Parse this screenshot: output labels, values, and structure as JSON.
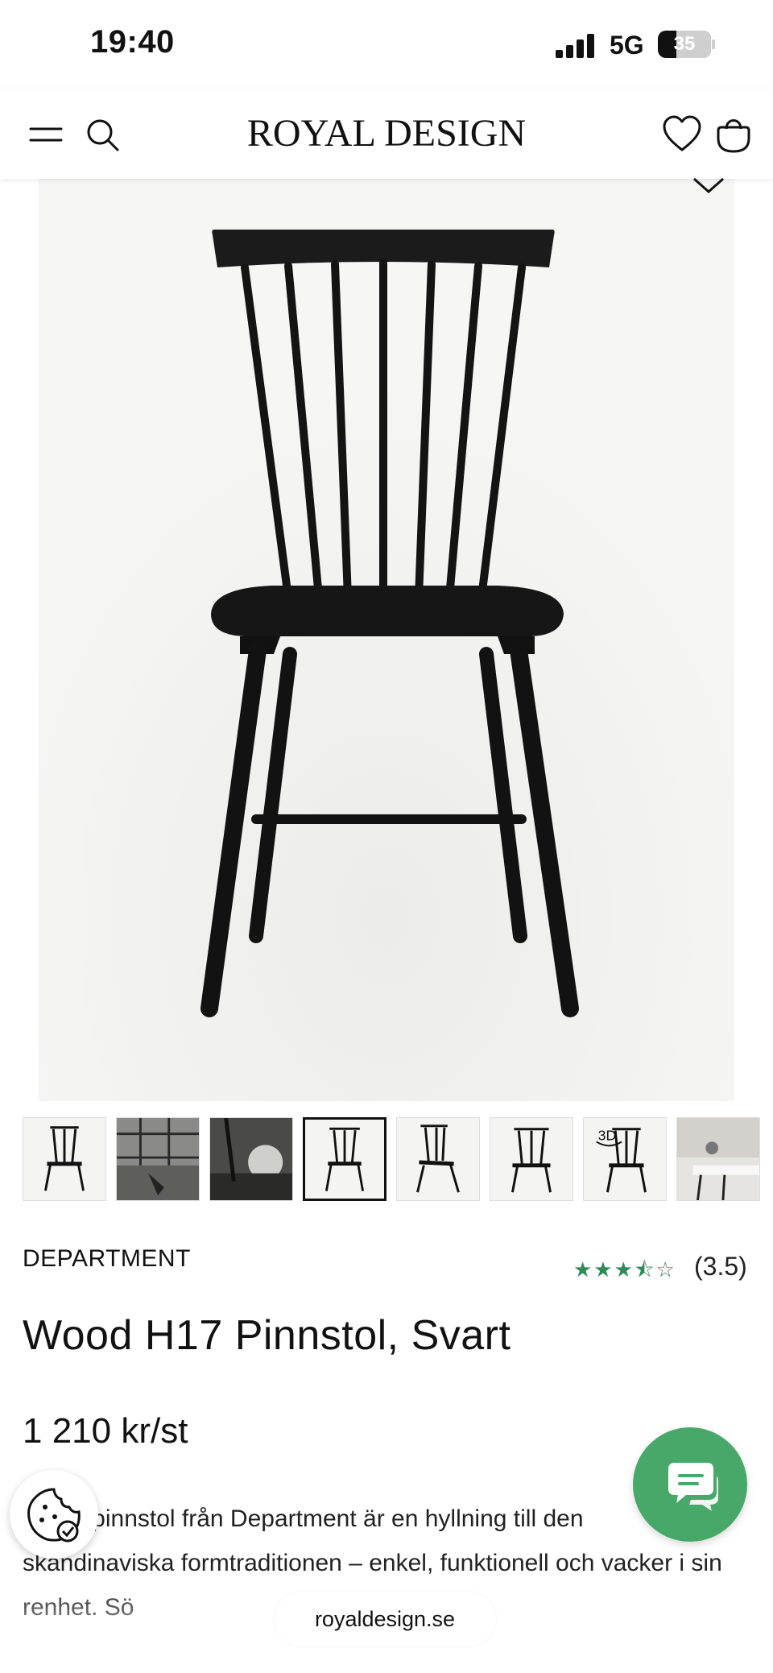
{
  "status_bar": {
    "time": "19:40",
    "network": "5G",
    "battery": "35",
    "battery_level": 0.35
  },
  "header": {
    "brand": "ROYAL DESIGN"
  },
  "icons": {
    "menu": "menu-icon",
    "search": "search-icon",
    "wishlist": "heart-icon",
    "cart": "bag-icon",
    "chat": "chat-icon",
    "cookie": "cookie-icon",
    "chevron": "chevron-down-icon"
  },
  "gallery": {
    "thumbnails": [
      {
        "name": "front-view"
      },
      {
        "name": "lifestyle-window"
      },
      {
        "name": "detail-closeup"
      },
      {
        "name": "front-view-selected",
        "selected": true
      },
      {
        "name": "side-view"
      },
      {
        "name": "back-view"
      },
      {
        "name": "3d-view",
        "badge": "3D"
      },
      {
        "name": "room-scene"
      }
    ]
  },
  "product": {
    "brand": "DEPARTMENT",
    "rating": 3.5,
    "rating_stars": "★★★⯪☆",
    "rating_text": "(3.5)",
    "title": "Wood H17 Pinnstol, Svart",
    "price": "1 210 kr/st",
    "description": "Wood pinnstol från Department är en hyllning till den skandinaviska formtraditionen – enkel, funktionell och vacker i sin renhet. Sö"
  },
  "browser": {
    "url": "royaldesign.se"
  },
  "colors": {
    "accent_green": "#47a86a",
    "star_green": "#2e8b57",
    "text": "#111111"
  }
}
